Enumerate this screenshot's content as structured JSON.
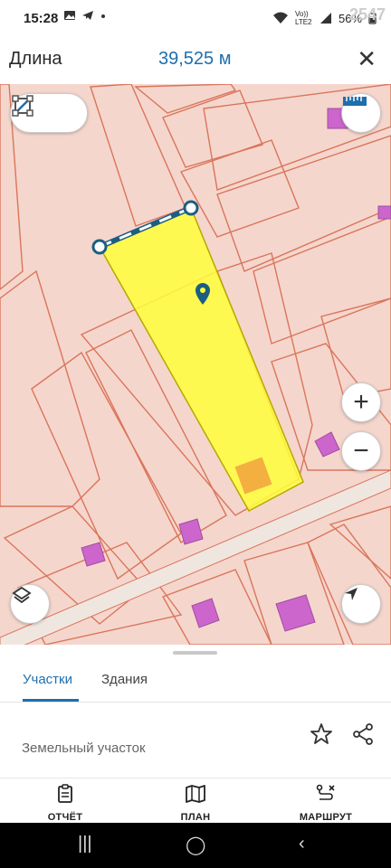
{
  "status_bar": {
    "time": "15:28",
    "left_icons": [
      "gallery-icon",
      "telegram-icon",
      "dot-icon"
    ],
    "network": "Vo)) LTE2",
    "battery": "56%",
    "overlay_text": "2547"
  },
  "header": {
    "title": "Длина",
    "value": "39,525 м",
    "close_icon": "close-icon"
  },
  "map": {
    "tools": [
      "line-measure-icon",
      "area-measure-icon"
    ],
    "ruler_icon": "ruler-icon",
    "zoom_in": "+",
    "zoom_out": "−",
    "layers_icon": "layers-icon",
    "location_icon": "navigation-arrow-icon",
    "colors": {
      "background": "#f5d6cc",
      "parcel_border": "#d9755c",
      "selected_parcel": "#ffff3a",
      "buildings": "#cc66cc",
      "measure_line": "#1b5e82"
    }
  },
  "sheet": {
    "tabs": [
      {
        "label": "Участки",
        "active": true
      },
      {
        "label": "Здания",
        "active": false
      }
    ],
    "parcel_type": "Земельный участок",
    "actions": [
      "star-icon",
      "share-icon"
    ]
  },
  "bottom_nav": [
    {
      "label": "ОТЧЁТ",
      "icon": "report-icon"
    },
    {
      "label": "ПЛАН",
      "icon": "map-plan-icon"
    },
    {
      "label": "МАРШРУТ",
      "icon": "route-icon"
    }
  ],
  "system_nav": [
    "recent-apps-icon",
    "home-icon",
    "back-icon"
  ]
}
